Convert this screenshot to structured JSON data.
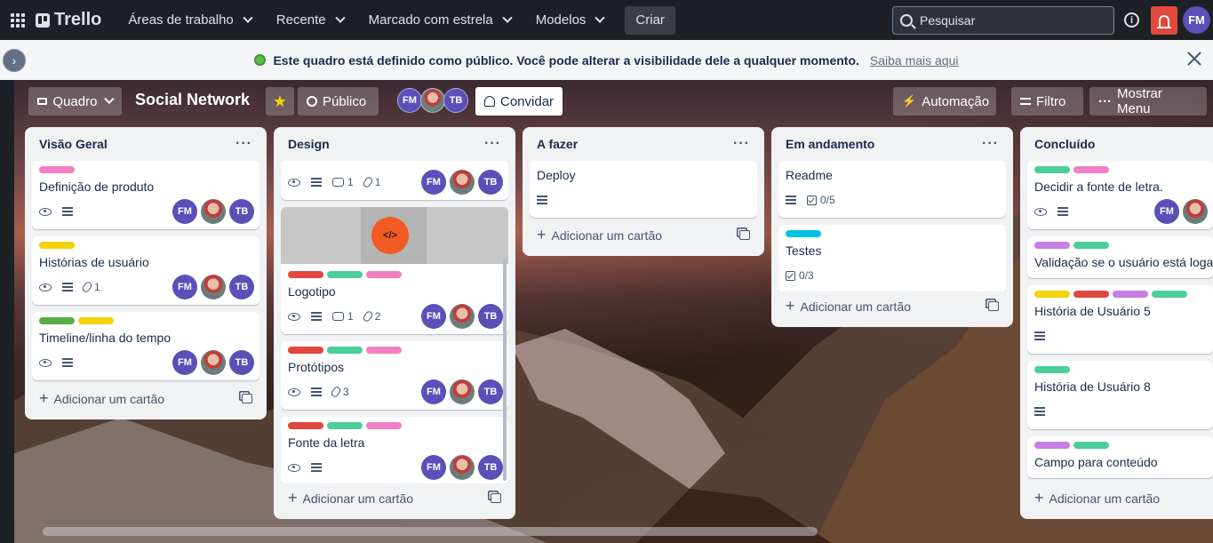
{
  "nav": {
    "brand": "Trello",
    "menus": [
      "Áreas de trabalho",
      "Recente",
      "Marcado com estrela",
      "Modelos"
    ],
    "create": "Criar",
    "search_placeholder": "Pesquisar",
    "user_initials": "FM"
  },
  "banner": {
    "text": "Este quadro está definido como público. Você pode alterar a visibilidade dele a qualquer momento.",
    "link": "Saiba mais aqui"
  },
  "board": {
    "view": "Quadro",
    "title": "Social Network",
    "visibility": "Público",
    "members": [
      "FM",
      "",
      "TB"
    ],
    "invite": "Convidar",
    "automation": "Automação",
    "filter": "Filtro",
    "menu": "Mostrar Menu",
    "add_card": "Adicionar um cartão"
  },
  "colors": {
    "green": "#4bce97",
    "pink": "#f17fc4",
    "yellow": "#f5d20b",
    "lime": "#5aac44",
    "red": "#e2483d",
    "purple": "#c77fe3",
    "cyan": "#00c2e0",
    "avatar": "#5c4fb8"
  },
  "lists": [
    {
      "title": "Visão Geral",
      "cards": [
        {
          "labels": [
            "pink"
          ],
          "title": "Definição de produto",
          "watch": true,
          "desc": true,
          "members": [
            "FM",
            "",
            "TB"
          ]
        },
        {
          "labels": [
            "yellow"
          ],
          "title": "Histórias de usuário",
          "watch": true,
          "desc": true,
          "attachments": "1",
          "members": [
            "FM",
            "",
            "TB"
          ]
        },
        {
          "labels": [
            "lime",
            "yellow"
          ],
          "title": "Timeline/linha do tempo",
          "watch": true,
          "desc": true,
          "members": [
            "FM",
            "",
            "TB"
          ]
        }
      ]
    },
    {
      "title": "Design",
      "cards": [
        {
          "labels": [],
          "title": "",
          "watch": true,
          "desc": true,
          "comments": "1",
          "attachments": "1",
          "members": [
            "FM",
            "",
            "TB"
          ]
        },
        {
          "cover": true,
          "cover_glyph": "</>",
          "labels": [
            "red",
            "green",
            "pink"
          ],
          "title": "Logotipo",
          "watch": true,
          "desc": true,
          "comments": "1",
          "attachments": "2",
          "members": [
            "FM",
            "",
            "TB"
          ]
        },
        {
          "labels": [
            "red",
            "green",
            "pink"
          ],
          "title": "Protótipos",
          "watch": true,
          "desc": true,
          "attachments": "3",
          "members": [
            "FM",
            "",
            "TB"
          ]
        },
        {
          "labels": [
            "red",
            "green",
            "pink"
          ],
          "title": "Fonte da letra",
          "watch": true,
          "desc": true,
          "members": [
            "FM",
            "",
            "TB"
          ]
        }
      ]
    },
    {
      "title": "A fazer",
      "cards": [
        {
          "labels": [],
          "title": "Deploy",
          "desc": true
        }
      ]
    },
    {
      "title": "Em andamento",
      "cards": [
        {
          "labels": [],
          "title": "Readme",
          "desc": true,
          "checklist": "0/5"
        },
        {
          "labels": [
            "cyan"
          ],
          "title": "Testes",
          "checklist": "0/3"
        }
      ]
    },
    {
      "title": "Concluído",
      "cards": [
        {
          "labels": [
            "green",
            "pink"
          ],
          "title": "Decidir a fonte de letra.",
          "watch": true,
          "desc": true,
          "members": [
            "FM",
            ""
          ]
        },
        {
          "labels": [
            "purple",
            "green"
          ],
          "title": "Validação se o usuário está logado"
        },
        {
          "labels": [
            "yellow",
            "red",
            "purple",
            "green"
          ],
          "title": "História de Usuário 5",
          "desc": true
        },
        {
          "labels": [
            "green"
          ],
          "title": "História de Usuário 8",
          "desc": true
        },
        {
          "labels": [
            "purple",
            "green"
          ],
          "title": "Campo para conteúdo"
        },
        {
          "labels": [
            "purple",
            "green"
          ],
          "title": ""
        }
      ]
    }
  ]
}
